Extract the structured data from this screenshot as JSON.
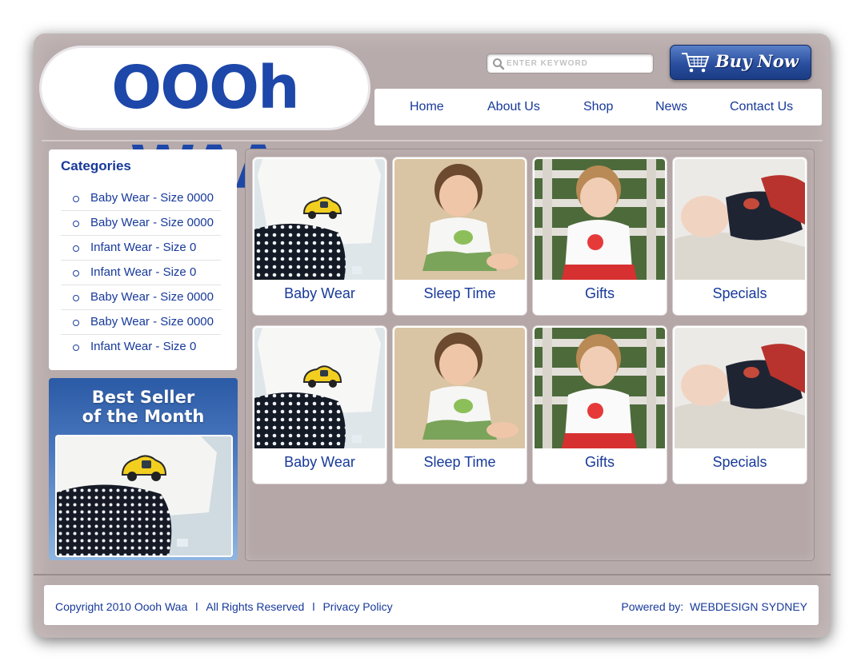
{
  "brand": {
    "logo_text": "OOOh WAA"
  },
  "search": {
    "placeholder": "ENTER KEYWORD",
    "value": ""
  },
  "buy_button": {
    "label": "Buy Now"
  },
  "nav": {
    "items": [
      {
        "label": "Home"
      },
      {
        "label": "About Us"
      },
      {
        "label": "Shop"
      },
      {
        "label": "News"
      },
      {
        "label": "Contact Us"
      }
    ]
  },
  "categories": {
    "title": "Categories",
    "items": [
      {
        "label": "Baby Wear - Size 0000"
      },
      {
        "label": "Baby Wear - Size 0000"
      },
      {
        "label": "Infant Wear - Size 0"
      },
      {
        "label": "Infant Wear - Size 0"
      },
      {
        "label": "Baby Wear - Size 0000"
      },
      {
        "label": "Baby Wear - Size 0000"
      },
      {
        "label": "Infant Wear - Size 0"
      }
    ]
  },
  "best_seller": {
    "line1": "Best Seller",
    "line2": "of the Month"
  },
  "products": [
    {
      "label": "Baby Wear",
      "image": "onesie-car"
    },
    {
      "label": "Sleep Time",
      "image": "toddler-sand"
    },
    {
      "label": "Gifts",
      "image": "toddler-bench"
    },
    {
      "label": "Specials",
      "image": "baby-blanket"
    },
    {
      "label": "Baby Wear",
      "image": "onesie-car"
    },
    {
      "label": "Sleep Time",
      "image": "toddler-sand"
    },
    {
      "label": "Gifts",
      "image": "toddler-bench"
    },
    {
      "label": "Specials",
      "image": "baby-blanket"
    }
  ],
  "footer": {
    "copyright": "Copyright  2010  Oooh Waa",
    "separator": "l",
    "rights": "All Rights Reserved",
    "privacy": "Privacy Policy",
    "powered_label": "Powered by:",
    "powered_link": "WEBDESIGN SYDNEY"
  },
  "colors": {
    "brand_blue": "#17399a",
    "frame": "#b8abab",
    "button_blue": "#2a4f9e"
  }
}
